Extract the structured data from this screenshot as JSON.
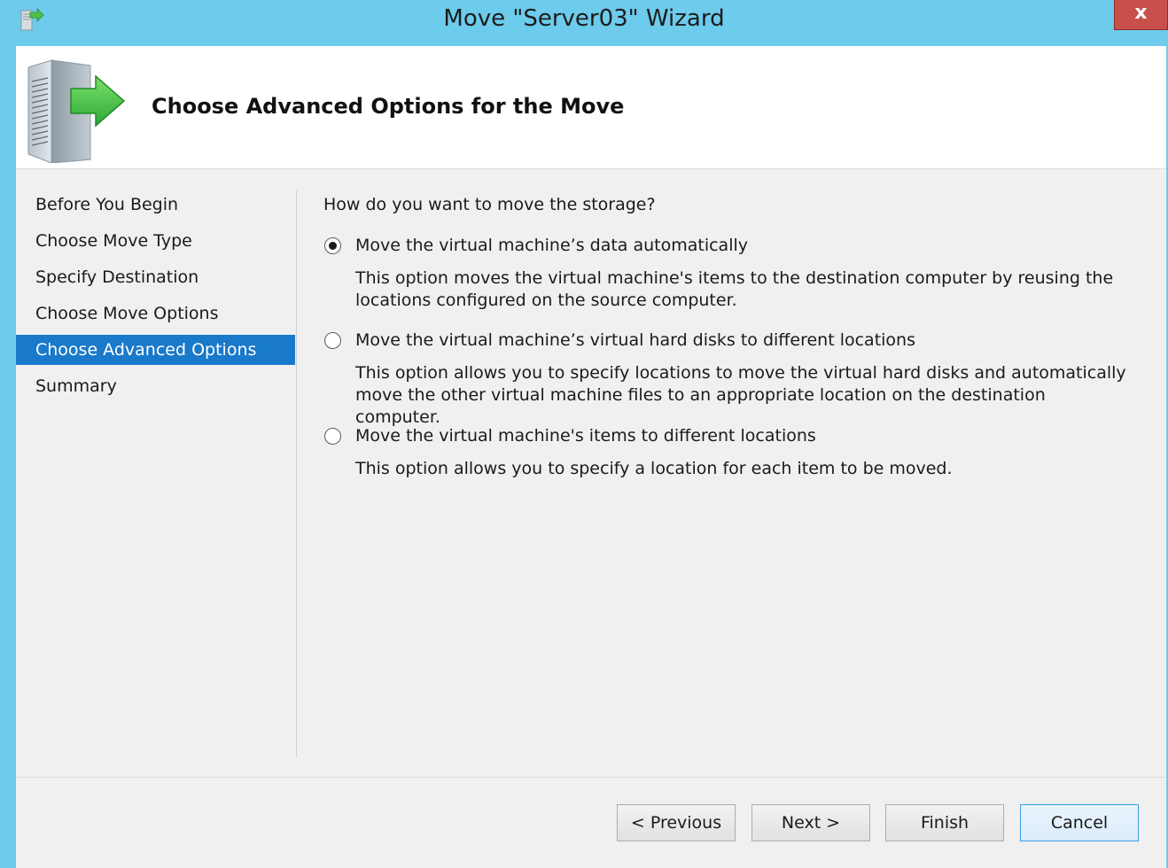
{
  "window": {
    "title": "Move \"Server03\" Wizard",
    "close_glyph": "x"
  },
  "header": {
    "title": "Choose Advanced Options for the Move",
    "icon": "server-move-icon"
  },
  "nav": {
    "items": [
      {
        "label": "Before You Begin",
        "selected": false
      },
      {
        "label": "Choose Move Type",
        "selected": false
      },
      {
        "label": "Specify Destination",
        "selected": false
      },
      {
        "label": "Choose Move Options",
        "selected": false
      },
      {
        "label": "Choose Advanced Options",
        "selected": true
      },
      {
        "label": "Summary",
        "selected": false
      }
    ]
  },
  "content": {
    "question": "How do you want to move the storage?",
    "options": [
      {
        "label": "Move the virtual machine’s data automatically",
        "description": "This option moves the virtual machine's items to the destination computer by reusing the locations configured on the source computer.",
        "checked": true
      },
      {
        "label": "Move the virtual machine’s virtual hard disks to different locations",
        "description": "This option allows you to specify locations to move the virtual hard disks and automatically move the other virtual machine files to an appropriate location on the destination computer.",
        "checked": false
      },
      {
        "label": "Move the virtual machine's items to different locations",
        "description": "This option allows you to specify a location for each item to be moved.",
        "checked": false
      }
    ]
  },
  "buttons": {
    "previous": "< Previous",
    "next": "Next >",
    "finish": "Finish",
    "cancel": "Cancel"
  },
  "colors": {
    "titlebar": "#6dcbec",
    "selection": "#1979ca",
    "close": "#c7504b"
  }
}
